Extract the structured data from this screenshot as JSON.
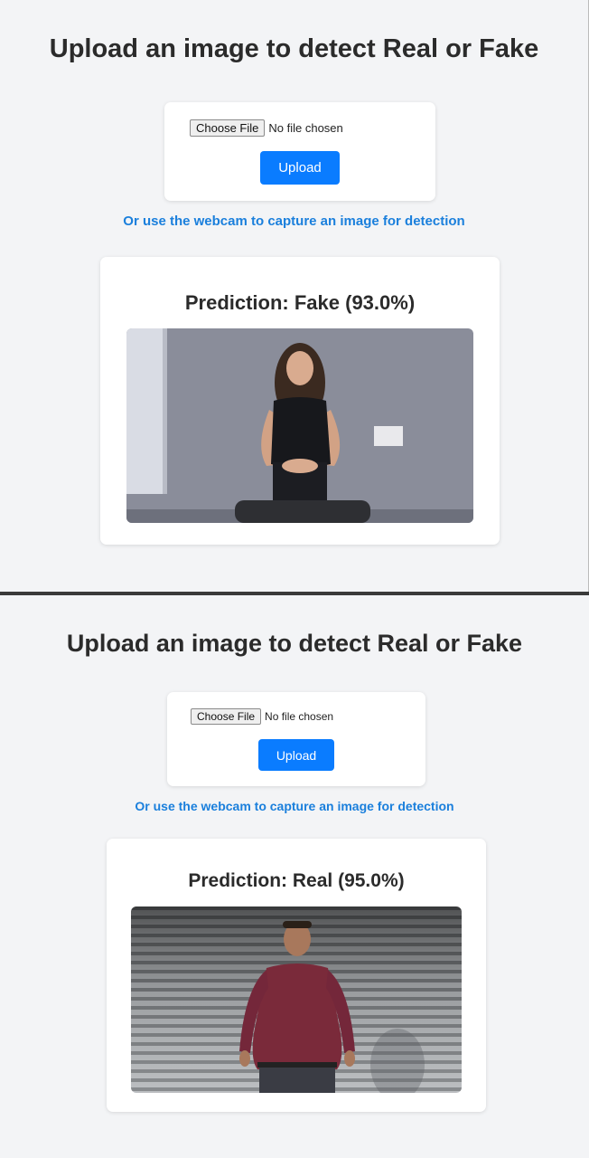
{
  "top": {
    "title": "Upload an image to detect Real or Fake",
    "choose_file_label": "Choose File",
    "file_status": "No file chosen",
    "upload_label": "Upload",
    "webcam_link": "Or use the webcam to capture an image for detection",
    "prediction": "Prediction: Fake (93.0%)"
  },
  "bottom": {
    "title": "Upload an image to detect Real or Fake",
    "choose_file_label": "Choose File",
    "file_status": "No file chosen",
    "upload_label": "Upload",
    "webcam_link": "Or use the webcam to capture an image for detection",
    "prediction": "Prediction: Real (95.0%)"
  },
  "colors": {
    "accent": "#0a7cff",
    "link": "#1a7fdc",
    "background": "#f3f4f6"
  }
}
